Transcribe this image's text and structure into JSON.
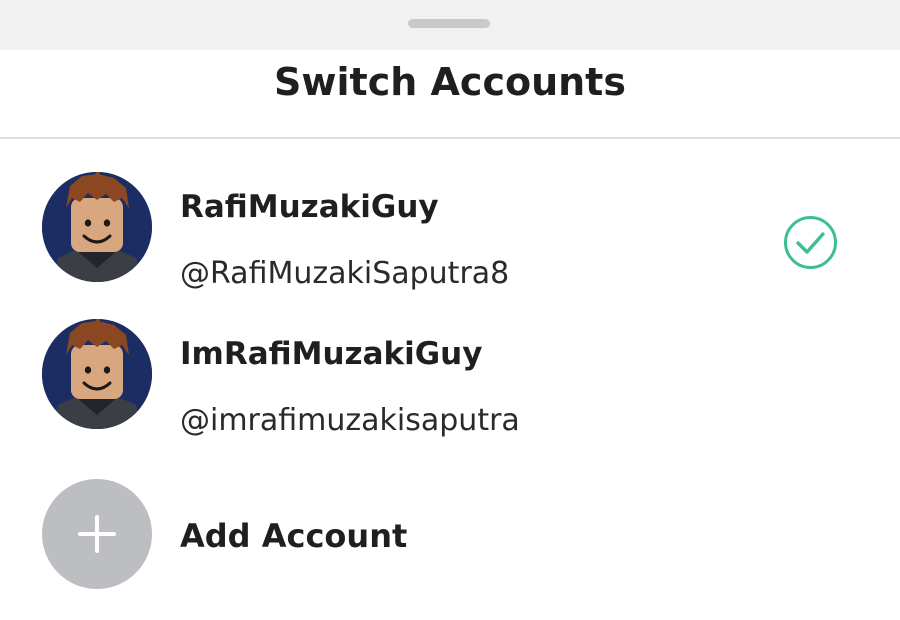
{
  "sheet": {
    "title": "Switch Accounts"
  },
  "accounts": [
    {
      "display_name": "RafiMuzakiGuy",
      "username": "@RafiMuzakiSaputra8",
      "selected": true,
      "avatar_icon": "roblox-avatar-icon"
    },
    {
      "display_name": "ImRafiMuzakiGuy",
      "username": "@imrafimuzakisaputra",
      "selected": false,
      "avatar_icon": "roblox-avatar-icon"
    }
  ],
  "add_account": {
    "label": "Add Account",
    "icon": "plus-icon"
  },
  "colors": {
    "check_accent": "#3cc08f",
    "avatar_background": "#1c2d63",
    "add_circle": "#bdbec1",
    "drag_bar_bg": "#f1f1f1",
    "divider": "#dedede"
  }
}
